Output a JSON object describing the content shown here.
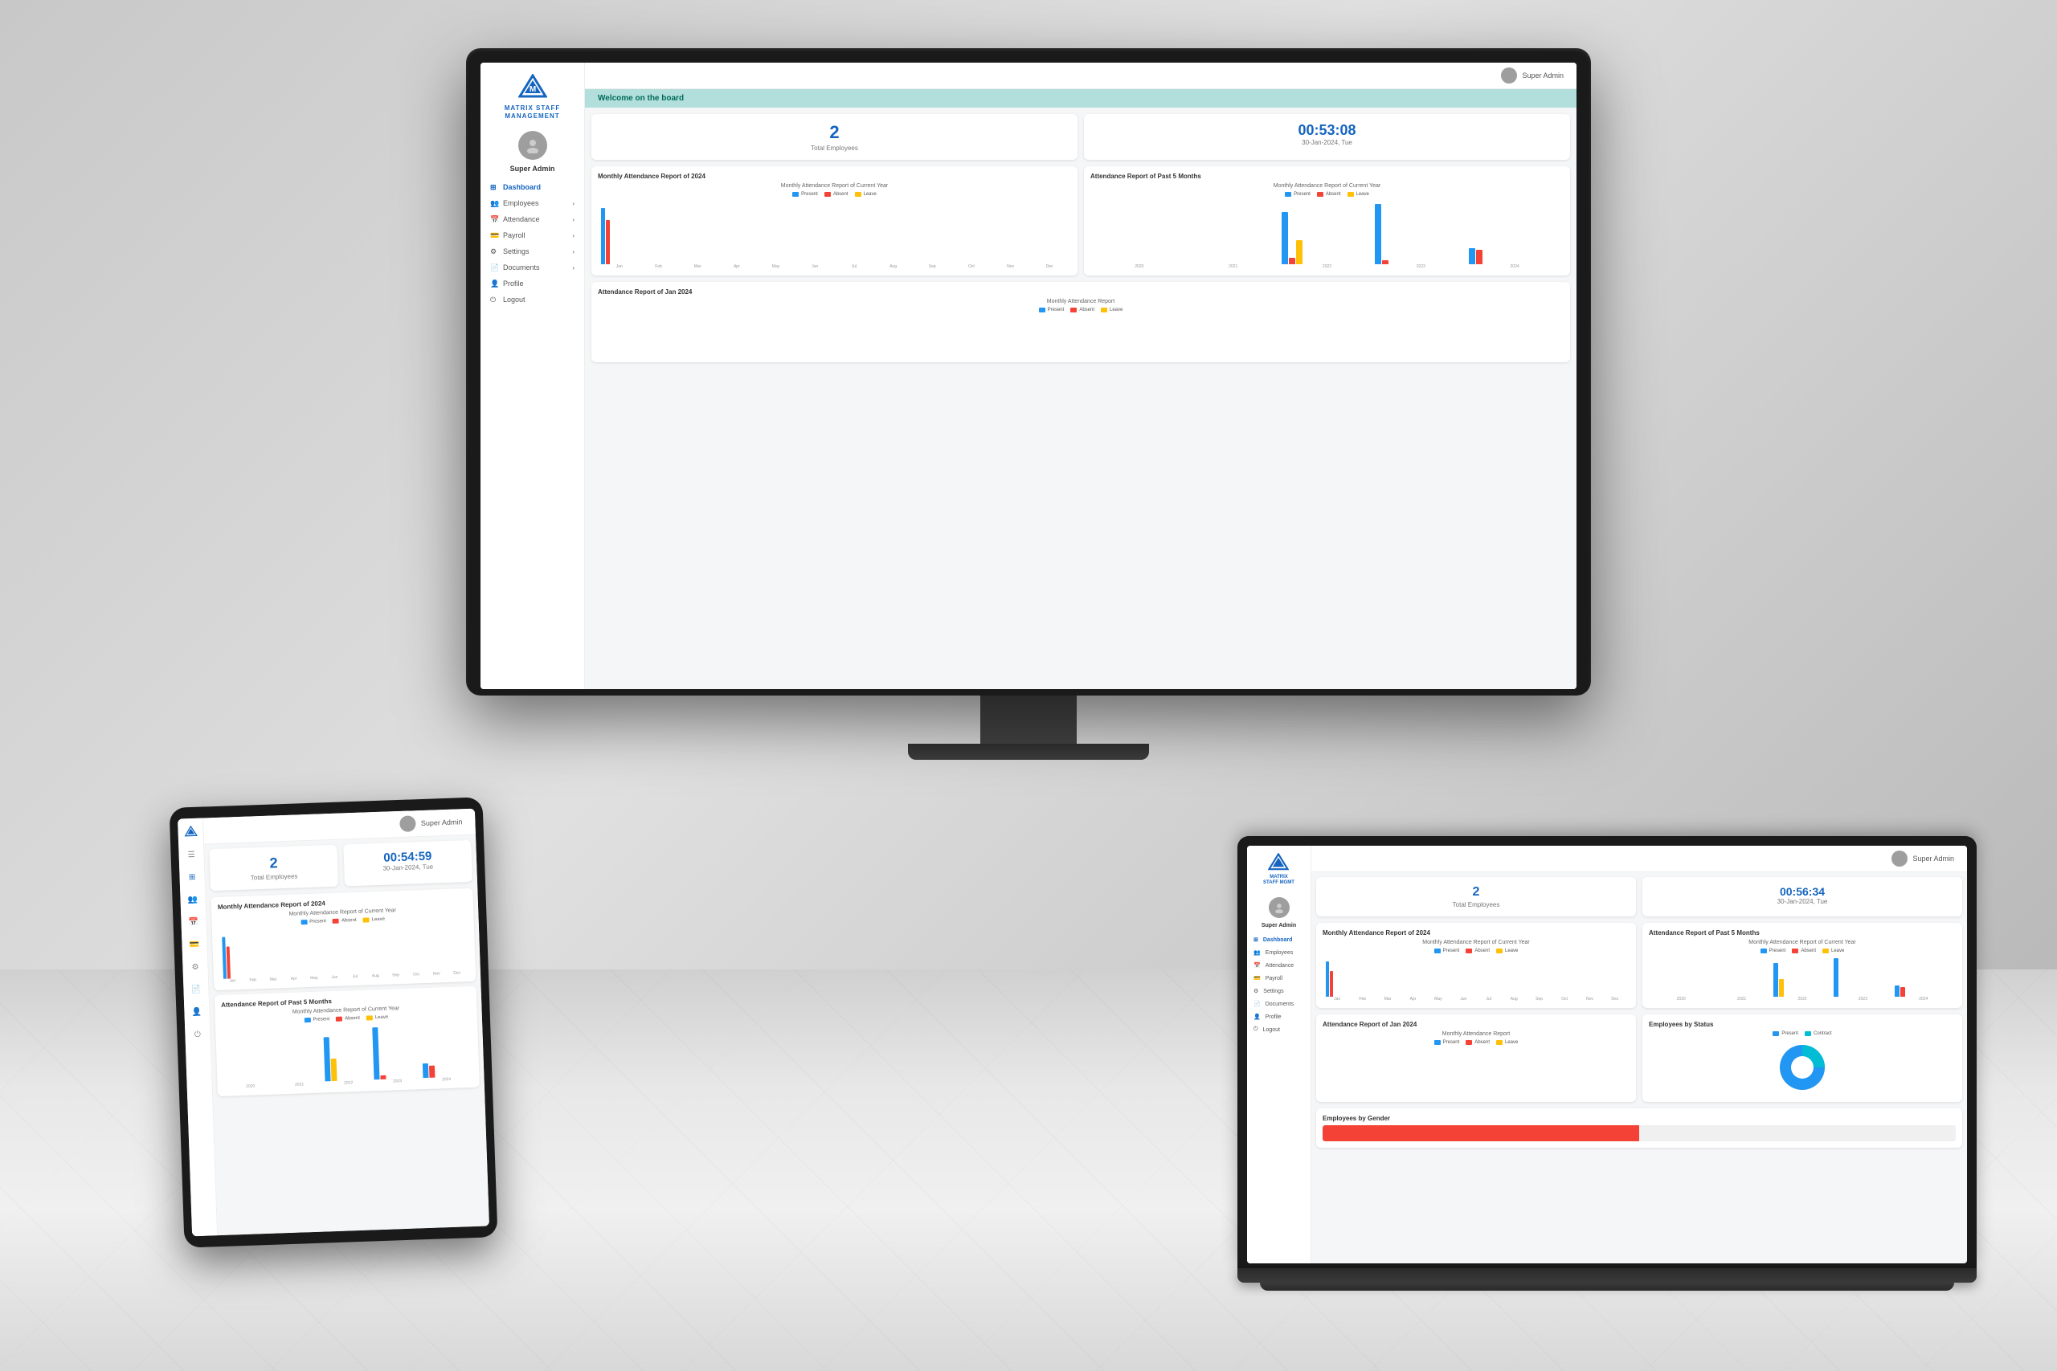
{
  "background": {
    "color": "#c8c8c8"
  },
  "monitor": {
    "screen": {
      "topbar": {
        "user": "Super Admin"
      },
      "welcome": "Welcome on the board",
      "stats": {
        "employees": {
          "value": "2",
          "label": "Total Employees"
        },
        "time": {
          "value": "00:53:08",
          "date": "30-Jan-2024, Tue"
        }
      },
      "charts": {
        "monthly_title": "Monthly Attendance Report of 2024",
        "monthly_subtitle": "Monthly Attendance Report of Current Year",
        "past5_title": "Attendance Report of Past 5 Months",
        "past5_subtitle": "Monthly Attendance Report of Current Year",
        "jan2024_title": "Attendance Report of Jan 2024",
        "monthly_report_subtitle": "Monthly Attendance Report"
      },
      "legend": {
        "present": "Present",
        "absent": "Absent",
        "leave": "Leave"
      },
      "months": [
        "Jan",
        "Feb",
        "Mar",
        "Apr",
        "May",
        "Jun",
        "Jul",
        "Aug",
        "Sep",
        "Oct",
        "Nov",
        "Dec"
      ],
      "past5years": [
        "2020",
        "2021",
        "2022",
        "2023",
        "2024"
      ],
      "sidebar": {
        "logo_text": "MATRIX\nSTAFF MANAGEMENT",
        "username": "Super Admin",
        "items": [
          {
            "label": "Dashboard",
            "active": true
          },
          {
            "label": "Employees",
            "arrow": true
          },
          {
            "label": "Attendance",
            "arrow": true
          },
          {
            "label": "Payroll",
            "arrow": true
          },
          {
            "label": "Settings",
            "arrow": true
          },
          {
            "label": "Documents",
            "arrow": true
          },
          {
            "label": "Profile"
          },
          {
            "label": "Logout"
          }
        ]
      }
    }
  },
  "tablet": {
    "topbar": {
      "user": "Super Admin"
    },
    "stats": {
      "employees": {
        "value": "2",
        "label": "Total Employees"
      },
      "time": {
        "value": "00:54:59",
        "date": "30-Jan-2024, Tue"
      }
    },
    "charts": {
      "monthly_title": "Monthly Attendance Report of 2024",
      "past5_title": "Attendance Report of Past 5 Months"
    }
  },
  "laptop": {
    "topbar": {
      "user": "Super Admin"
    },
    "stats": {
      "employees": {
        "value": "2",
        "label": "Total Employees"
      },
      "time": {
        "value": "00:56:34",
        "date": "30-Jan-2024, Tue"
      }
    },
    "charts": {
      "monthly_title": "Monthly Attendance Report of 2024",
      "past5_title": "Attendance Report of Past 5 Months",
      "jan2024_title": "Attendance Report of Jan 2024",
      "emp_status_title": "Employees by Status",
      "emp_gender_title": "Employees by Gender"
    },
    "sidebar": {
      "items": [
        {
          "label": "Dashboard",
          "active": true
        },
        {
          "label": "Employees"
        },
        {
          "label": "Attendance"
        },
        {
          "label": "Payroll"
        },
        {
          "label": "Settings"
        },
        {
          "label": "Documents"
        },
        {
          "label": "Profile"
        },
        {
          "label": "Logout"
        }
      ]
    }
  }
}
